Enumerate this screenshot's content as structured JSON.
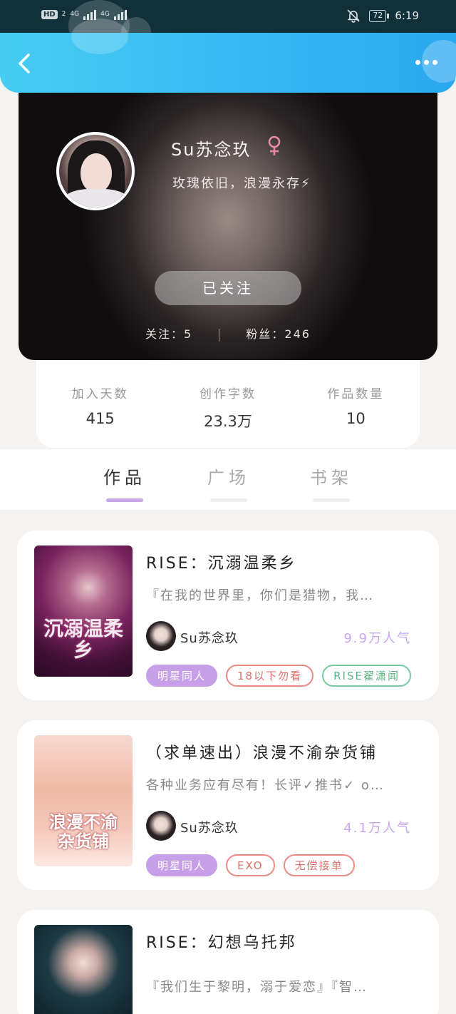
{
  "status_bar": {
    "hd": "HD",
    "sim": "2",
    "net1": "4G",
    "net2": "4G",
    "battery": "72",
    "time": "6:19"
  },
  "profile": {
    "username": "Su苏念玖",
    "gender_symbol": "♀",
    "bio": "玫瑰依旧，浪漫永存⚡",
    "follow_button": "已关注",
    "following_label": "关注：5",
    "fans_label": "粉丝：246"
  },
  "stats": [
    {
      "label": "加入天数",
      "value": "415"
    },
    {
      "label": "创作字数",
      "value": "23.3万"
    },
    {
      "label": "作品数量",
      "value": "10"
    }
  ],
  "tabs": [
    {
      "label": "作品"
    },
    {
      "label": "广场"
    },
    {
      "label": "书架"
    }
  ],
  "books": [
    {
      "title": "RISE：沉溺温柔乡",
      "description": "『在我的世界里，你们是猎物，我…",
      "author": "Su苏念玖",
      "popularity": "9.9万人气",
      "cover_text": "沉溺温柔乡",
      "tags": [
        "明星同人",
        "18以下勿看",
        "RISE翟潇闻"
      ]
    },
    {
      "title": "（求单速出）浪漫不渝杂货铺",
      "description": "各种业务应有尽有！长评✓推书✓ o…",
      "author": "Su苏念玖",
      "popularity": "4.1万人气",
      "cover_text": "浪漫不渝杂货铺",
      "tags": [
        "明星同人",
        "EXO",
        "无偿接单"
      ]
    },
    {
      "title": "RISE：幻想乌托邦",
      "description": "『我们生于黎明，溺于爱恋』『智…",
      "author": "",
      "popularity": "",
      "cover_text": "",
      "tags": []
    }
  ],
  "colors": {
    "header_gradient_start": "#46cdf3",
    "header_gradient_end": "#2aa8f0",
    "accent_purple": "#c79fe9",
    "tag_red": "#e98c86",
    "tag_green": "#7cc8a0",
    "female_pink": "#e88aa6"
  },
  "icons": {
    "back": "chevron-left-icon",
    "more": "more-dots-icon",
    "gender": "female-icon",
    "mute": "bell-off-icon"
  }
}
